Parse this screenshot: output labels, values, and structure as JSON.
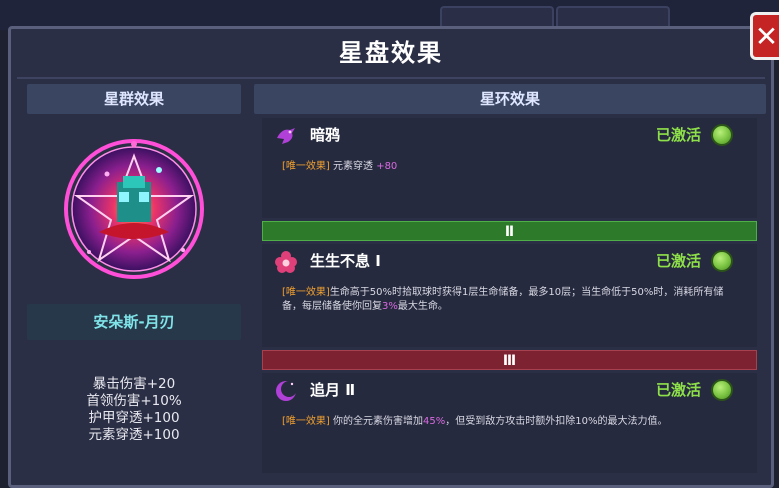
{
  "panel": {
    "title": "星盘效果"
  },
  "left": {
    "header": "星群效果",
    "emblem_name": "安朵斯-月刃",
    "stats": [
      "暴击伤害+20",
      "首领伤害+10%",
      "护甲穿透+100",
      "元素穿透+100"
    ]
  },
  "right": {
    "header": "星环效果",
    "effects": [
      {
        "name": "暗鸦",
        "status": "已激活",
        "tag": "[唯一效果]",
        "desc_a": "元素穿透",
        "value": "+80",
        "desc_b": "",
        "icon": "crow-icon"
      },
      {
        "name": "生生不息 Ⅰ",
        "status": "已激活",
        "tag": "[唯一效果]",
        "desc_a": "生命高于50%时拾取球时获得1层生命储备，最多10层；当生命低于50%时，消耗所有储备，每层储备使你回复",
        "value": "3%",
        "desc_b": "最大生命。",
        "icon": "flower-icon"
      },
      {
        "name": "追月 Ⅱ",
        "status": "已激活",
        "tag": "[唯一效果]",
        "desc_a": "你的全元素伤害增加",
        "value": "45%",
        "desc_b": "，但受到敌方攻击时额外扣除10%的最大法力值。",
        "icon": "crescent-moon-icon"
      }
    ],
    "dividers": [
      "Ⅱ",
      "Ⅲ"
    ]
  },
  "colors": {
    "active": "#8ee04a",
    "tag": "#f0a030",
    "highlight": "#d86ae0",
    "divider_green": "#2d7a2a",
    "divider_red": "#7d2230",
    "close": "#c42424"
  }
}
